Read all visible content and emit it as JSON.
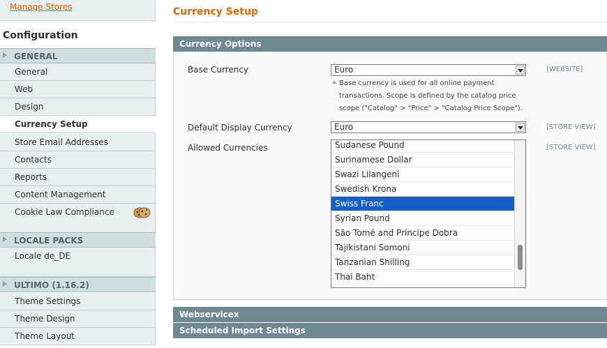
{
  "sidebar": {
    "store_link": "Manage Stores",
    "config_title": "Configuration",
    "sections": [
      {
        "title": "GENERAL",
        "items": [
          {
            "label": "General"
          },
          {
            "label": "Web"
          },
          {
            "label": "Design"
          },
          {
            "label": "Currency Setup",
            "active": true
          },
          {
            "label": "Store Email Addresses"
          },
          {
            "label": "Contacts"
          },
          {
            "label": "Reports"
          },
          {
            "label": "Content Management"
          },
          {
            "label": "Cookie Law Compliance",
            "icon": "cookie-icon"
          }
        ]
      },
      {
        "title": "LOCALE PACKS",
        "items": [
          {
            "label": "Locale de_DE"
          }
        ]
      },
      {
        "title": "ULTIMO (1.16.2)",
        "items": [
          {
            "label": "Theme Settings"
          },
          {
            "label": "Theme Design"
          },
          {
            "label": "Theme Layout"
          }
        ]
      }
    ]
  },
  "main": {
    "page_title": "Currency Setup",
    "fieldset_title": "Currency Options",
    "base_currency": {
      "label": "Base Currency",
      "value": "Euro",
      "scope": "[WEBSITE]",
      "note_lines": [
        "Base currency is used for all online payment",
        "transactions. Scope is defined by the catalog price",
        "scope (\"Catalog\" > \"Price\" > \"Catalog Price Scope\")."
      ]
    },
    "default_display_currency": {
      "label": "Default Display Currency",
      "value": "Euro",
      "scope": "[STORE VIEW]"
    },
    "allowed_currencies": {
      "label": "Allowed Currencies",
      "scope": "[STORE VIEW]",
      "options": [
        {
          "label": "Sudanese Pound"
        },
        {
          "label": "Surinamese Dollar"
        },
        {
          "label": "Swazi Lilangeni"
        },
        {
          "label": "Swedish Krona"
        },
        {
          "label": "Swiss Franc",
          "selected": true
        },
        {
          "label": "Syrian Pound"
        },
        {
          "label": "São Tomé and Príncipe Dobra"
        },
        {
          "label": "Tajikistani Somoni"
        },
        {
          "label": "Tanzanian Shilling"
        },
        {
          "label": "Thai Baht"
        }
      ]
    },
    "collapsed_sections": [
      {
        "title": "Webservicex"
      },
      {
        "title": "Scheduled Import Settings"
      }
    ]
  },
  "colors": {
    "accent": "#e26703",
    "link": "#eb5e00",
    "fieldset_header": "#6f8992",
    "selection": "#1560c4"
  }
}
